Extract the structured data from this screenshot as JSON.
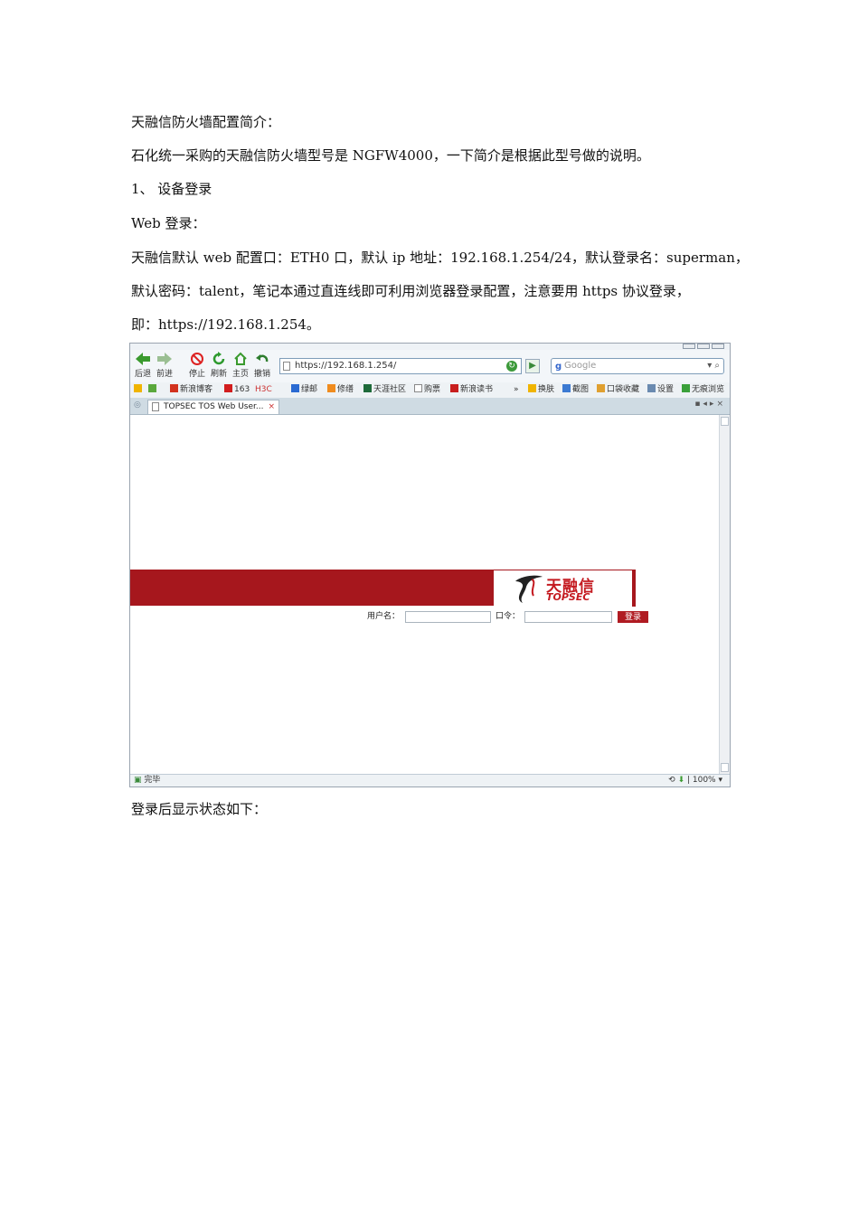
{
  "doc": {
    "heading": "天融信防火墙配置简介：",
    "p_model": "石化统一采购的天融信防火墙型号是 NGFW4000，一下简介是根据此型号做的说明。",
    "section1": "1、 设备登录",
    "web_login": "Web 登录：",
    "p_default_line1": "天融信默认 web 配置口：ETH0 口，默认 ip 地址：192.168.1.254/24，默认登录名：superman，",
    "p_default_line2": "默认密码：talent，笔记本通过直连线即可利用浏览器登录配置，注意要用 https 协议登录，",
    "p_default_line3": "即：https://192.168.1.254。",
    "after_login": "登录后显示状态如下："
  },
  "browser": {
    "toolbar": {
      "back": "后退",
      "forward": "前进",
      "stop": "停止",
      "refresh": "刷新",
      "home": "主页",
      "undo": "撤销"
    },
    "address": "https://192.168.1.254/",
    "search_placeholder": "Google",
    "favorites": [
      "新浪博客",
      "163",
      "H3C",
      "绿邮",
      "修缮",
      "天涯社区",
      "购票",
      "新浪读书"
    ],
    "favorites_right": [
      "换肤",
      "截图",
      "口袋收藏",
      "设置",
      "无痕浏览"
    ],
    "tab_title": "TOPSEC TOS Web User...",
    "status_left": "完毕",
    "zoom": "100%"
  },
  "login_page": {
    "brand_cn": "天融信",
    "brand_en": "TOPSEC",
    "username_label": "用户名：",
    "password_label": "口令：",
    "login_button": "登录"
  },
  "colors": {
    "brand_red": "#a6171d"
  }
}
